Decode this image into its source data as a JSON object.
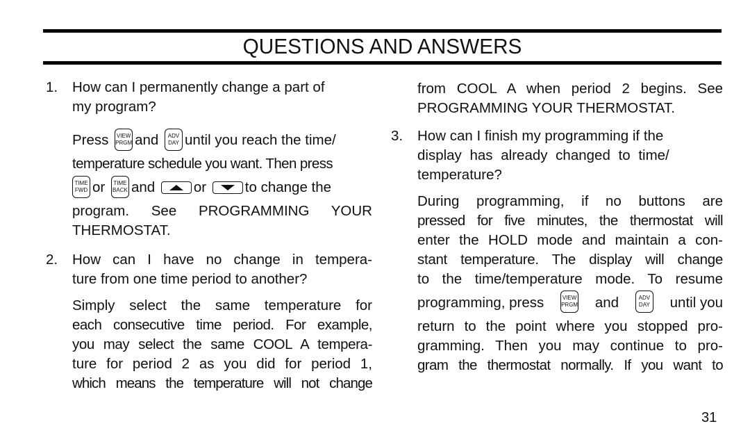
{
  "header": {
    "title": "QUESTIONS AND ANSWERS"
  },
  "keys": {
    "view_prgm": [
      "VIEW",
      "PRGM"
    ],
    "adv_day": [
      "ADV",
      "DAY"
    ],
    "time_fwd": [
      "TIME",
      "FWD"
    ],
    "time_back": [
      "TIME",
      "BACK"
    ],
    "up_arrow": "up-arrow",
    "down_arrow": "down-arrow"
  },
  "q1": {
    "number": "1.",
    "question_lines": [
      "How can I permanently change a part of",
      "my program?"
    ],
    "answer": {
      "press": "Press",
      "and1": "and",
      "until": "until you reach the time/",
      "line2": "temperature schedule you want. Then press",
      "or1": "or",
      "and2": "and",
      "or2": "or",
      "to_change": "to change the",
      "line4": "program. See PROGRAMMING YOUR",
      "line5": "THERMOSTAT."
    }
  },
  "q2": {
    "number": "2.",
    "question_lines": [
      "How can I have no change in tempera-",
      "ture from one time period to another?"
    ],
    "answer_lines": [
      "Simply select the same temperature for",
      "each consecutive time period. For example,",
      "you may select the same COOL A tempera-",
      "ture for period 2 as you did for period 1,",
      "which means the temperature will not change"
    ],
    "continued_lines": [
      "from COOL A when period 2 begins. See",
      "PROGRAMMING YOUR THERMOSTAT."
    ]
  },
  "q3": {
    "number": "3.",
    "question_lines": [
      "How can I finish my programming if the",
      "display has already changed to time/",
      "temperature?"
    ],
    "answer_lines": [
      "During programming, if no buttons are",
      "pressed for five minutes, the thermostat will",
      "enter the HOLD mode and maintain a con-",
      "stant temperature. The display will change",
      "to the time/temperature mode. To resume"
    ],
    "press_line": {
      "prefix": "programming, press",
      "and": "and",
      "suffix": "until you"
    },
    "after_lines": [
      "return to the point where you stopped pro-",
      "gramming. Then you may continue to pro-",
      "gram the thermostat normally. If you want to"
    ]
  },
  "footer": {
    "page_number": "31"
  }
}
